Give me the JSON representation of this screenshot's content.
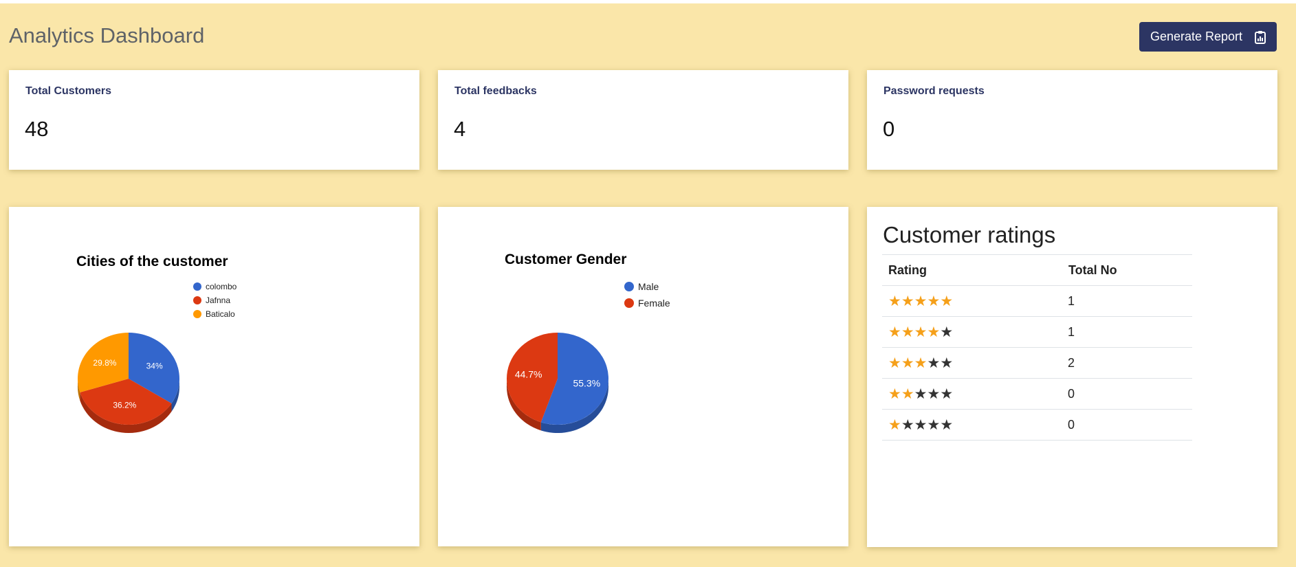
{
  "header": {
    "title": "Analytics Dashboard",
    "report_button": "Generate Report",
    "report_icon": "clipboard-icon"
  },
  "stats": [
    {
      "label": "Total Customers",
      "value": "48"
    },
    {
      "label": "Total feedbacks",
      "value": "4"
    },
    {
      "label": "Password requests",
      "value": "0"
    }
  ],
  "chart_data": [
    {
      "type": "pie",
      "title": "Cities of the customer",
      "labels": [
        "colombo",
        "Jafnna",
        "Baticalo"
      ],
      "values": [
        34,
        36.2,
        29.8
      ],
      "value_labels": [
        "34%",
        "36.2%",
        "29.8%"
      ],
      "colors": [
        "#3366cc",
        "#dc3912",
        "#ff9900"
      ],
      "legend": "right"
    },
    {
      "type": "pie",
      "title": "Customer Gender",
      "labels": [
        "Male",
        "Female"
      ],
      "values": [
        55.3,
        44.7
      ],
      "value_labels": [
        "55.3%",
        "44.7%"
      ],
      "colors": [
        "#3366cc",
        "#dc3912"
      ],
      "legend": "right"
    }
  ],
  "ratings": {
    "title": "Customer ratings",
    "headers": [
      "Rating",
      "Total No"
    ],
    "rows": [
      {
        "stars": 5,
        "total": "1"
      },
      {
        "stars": 4,
        "total": "1"
      },
      {
        "stars": 3,
        "total": "2"
      },
      {
        "stars": 2,
        "total": "0"
      },
      {
        "stars": 1,
        "total": "0"
      }
    ],
    "star_color": "#f5a01a"
  }
}
